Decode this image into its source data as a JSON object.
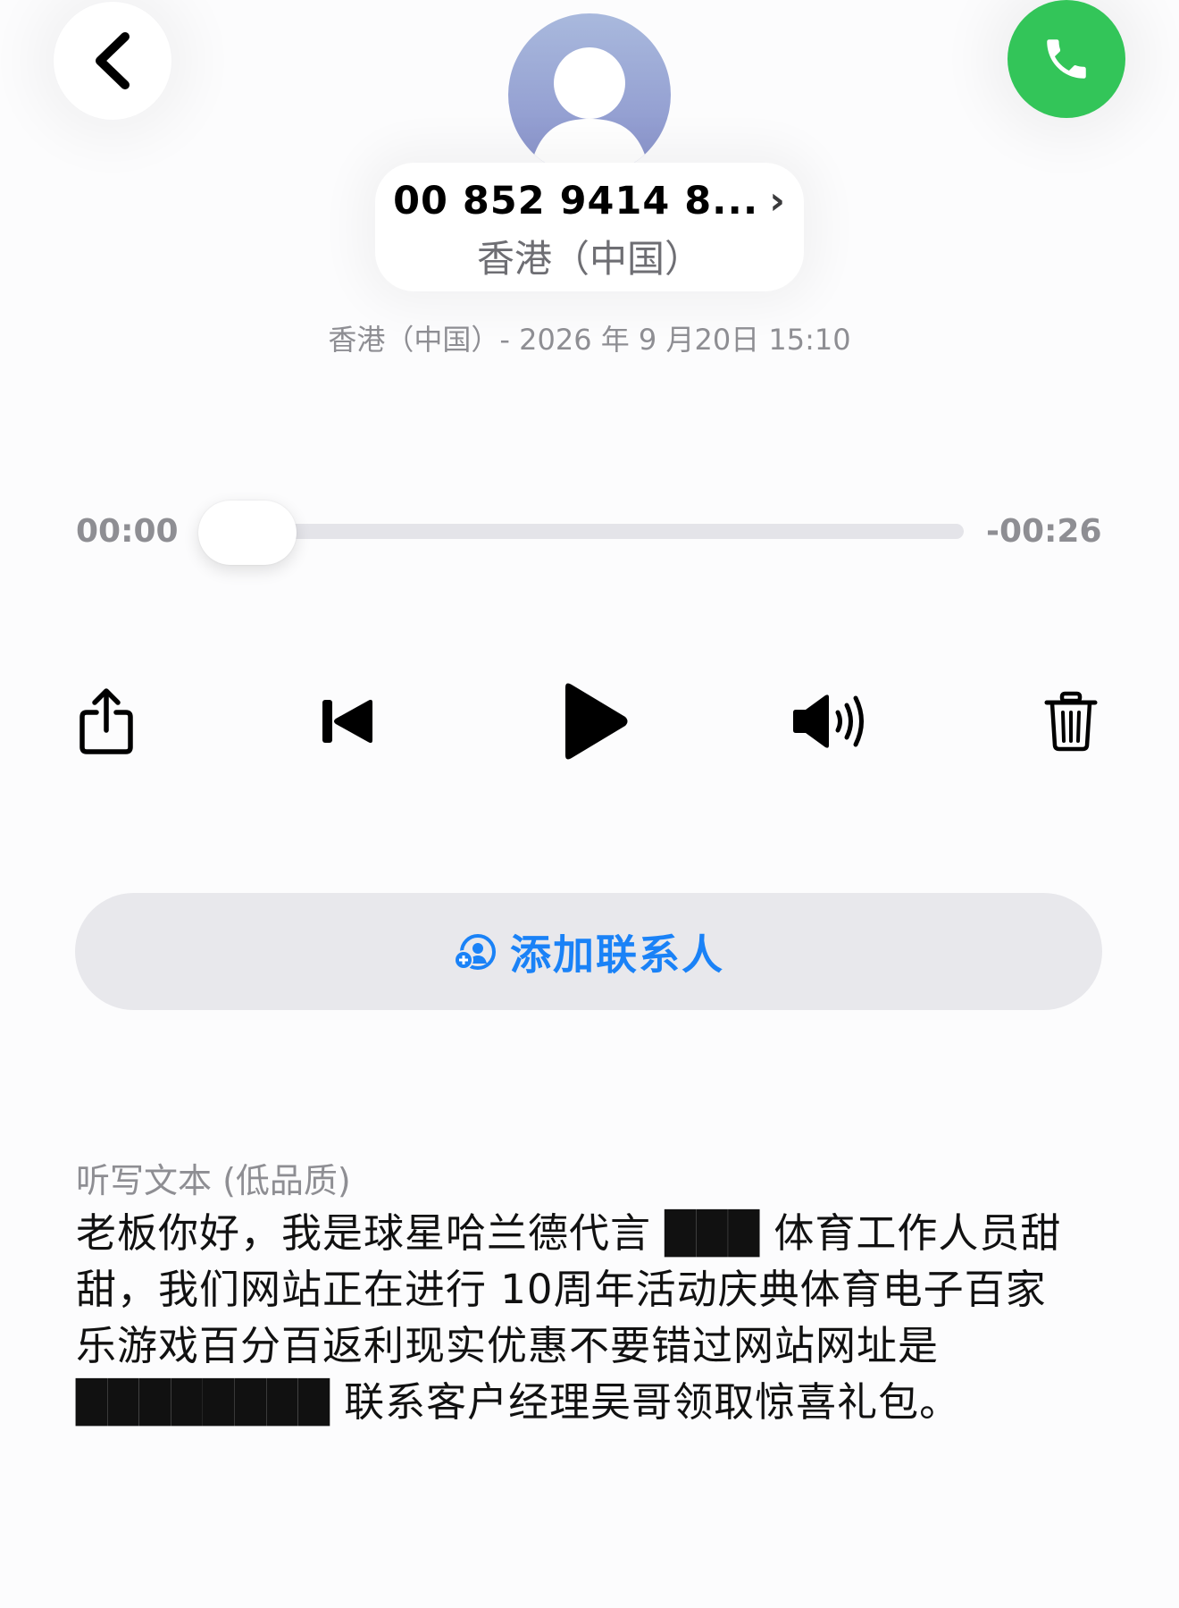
{
  "header": {
    "back_icon": "chevron-left-icon",
    "call_icon": "phone-icon",
    "call_color": "#33c559"
  },
  "caller": {
    "number": "00 852 9414 8...",
    "chevron": "›",
    "region": "香港（中国）",
    "avatar_icon": "person-icon"
  },
  "meta": {
    "subline": "香港（中国）- 2026 年 9 月20日 15:10"
  },
  "playback": {
    "elapsed": "00:00",
    "remaining": "-00:26",
    "progress": 0.0
  },
  "controls": {
    "share_icon": "share-icon",
    "rewind_icon": "skip-back-icon",
    "play_icon": "play-icon",
    "volume_icon": "speaker-volume-icon",
    "delete_icon": "trash-icon"
  },
  "add_contact": {
    "label": "添加联系人",
    "icon": "add-person-icon",
    "color": "#1a82f7"
  },
  "transcript": {
    "title": "听写文本 (低品质)",
    "body": "老板你好，我是球星哈兰德代言 ███ 体育工作人员甜甜，我们网站正在进行 10周年活动庆典体育电子百家乐游戏百分百返利现实优惠不要错过网站网址是 ████████ 联系客户经理吴哥领取惊喜礼包。"
  }
}
